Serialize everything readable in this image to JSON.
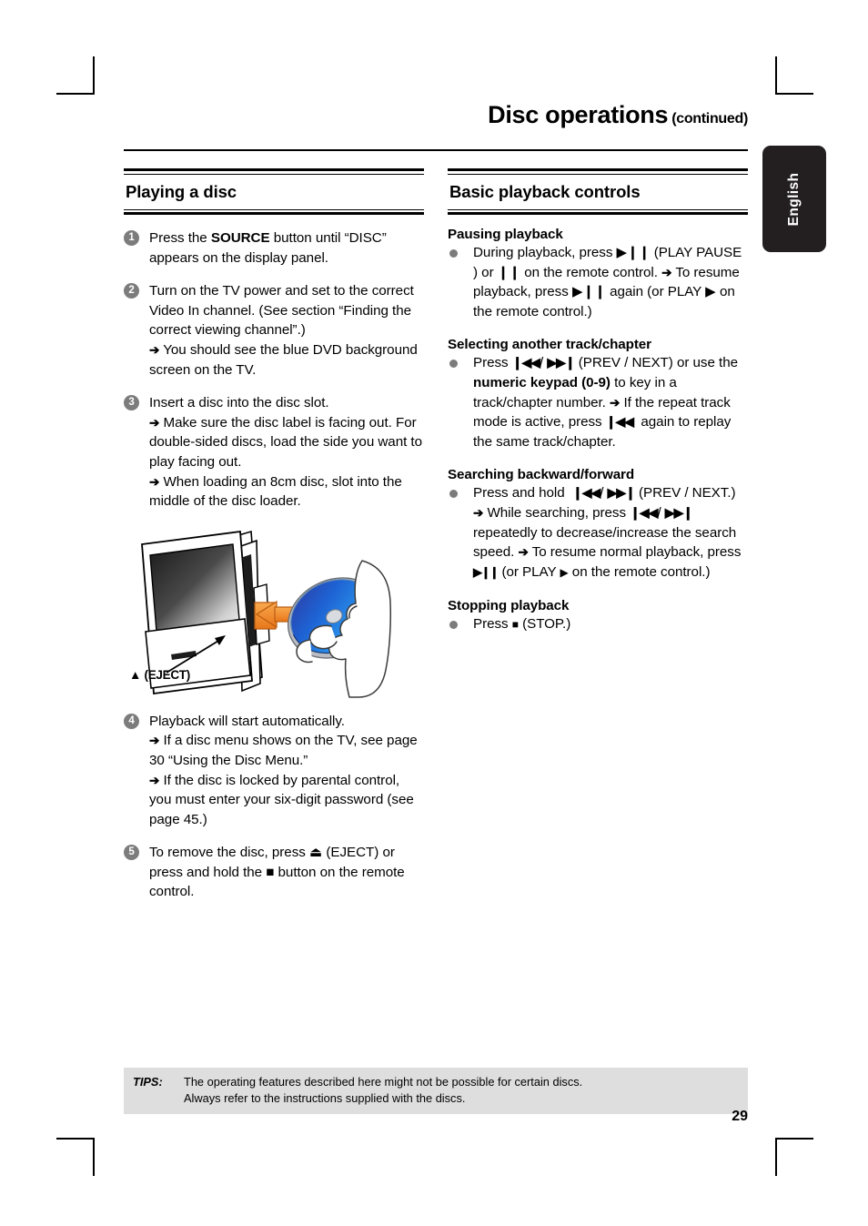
{
  "header": {
    "title": "Disc operations",
    "continued": "(continued)"
  },
  "lang_tab": {
    "label": "English",
    "bg": "#231f20",
    "fg": "#ffffff"
  },
  "left_column": {
    "heading": "Playing a disc",
    "steps": [
      {
        "num": "1",
        "lines": [
          {
            "type": "main",
            "text": "Press the ",
            "bold": "SOURCE",
            "tail": " button until “DISC” appears on the display panel."
          }
        ]
      },
      {
        "num": "2",
        "lines": [
          {
            "type": "main",
            "text": "Turn on the TV power and set to the correct Video In channel.  (See section “Finding the correct viewing channel”.)"
          },
          {
            "type": "arrow",
            "text": "You should see the blue DVD background screen on the TV."
          }
        ]
      },
      {
        "num": "3",
        "lines": [
          {
            "type": "main",
            "text": "Insert a disc into the disc slot."
          },
          {
            "type": "arrow",
            "text": "Make sure the disc label is facing out. For double-sided discs, load the side you want to play facing out."
          },
          {
            "type": "arrow",
            "text": "When loading an 8cm disc, slot into the middle of the disc loader."
          }
        ]
      },
      {
        "num": "4",
        "lines": [
          {
            "type": "main",
            "text": "Playback will start automatically."
          },
          {
            "type": "arrow",
            "text": "If a disc menu shows on the TV, see page 30 “Using the Disc Menu.”"
          },
          {
            "type": "arrow",
            "text": "If the disc is locked by parental control, you must enter your six-digit password (see page 45.)"
          }
        ]
      },
      {
        "num": "5",
        "lines": [
          {
            "type": "main",
            "text": "To remove the disc, press ⏏ (EJECT) or press and hold the ■ button on the remote control."
          }
        ]
      }
    ],
    "figure": {
      "caption": "▲ (EJECT)",
      "description": "flat-panel DVD player with hand inserting blue disc",
      "arrow_color": "#f08c2a",
      "disc_color": "#1656c8"
    }
  },
  "right_column": {
    "heading": "Basic playback controls",
    "sections": [
      {
        "title": "Pausing playback",
        "lines": [
          {
            "type": "main",
            "text": "During playback, press ▶❙❙  (PLAY PAUSE ) or ❙❙  on the remote control."
          },
          {
            "type": "arrow",
            "text": "To resume playback, press ▶❙❙ again (or PLAY ▶ on the remote control.)"
          }
        ]
      },
      {
        "title": "Selecting another track/chapter",
        "lines": [
          {
            "type": "main",
            "text": "Press ❙◀◀/ ▶▶❙ (PREV / NEXT) or use the numeric keypad (0-9) to key in a track/chapter number."
          },
          {
            "type": "arrow",
            "text": "If the repeat track mode is active, press ❙◀◀  again to replay the same track/chapter."
          }
        ]
      },
      {
        "title": "Searching backward/forward",
        "lines": [
          {
            "type": "main",
            "text": "Press and hold  ❙◀◀/ ▶▶❙ (PREV / NEXT.)"
          },
          {
            "type": "arrow",
            "text": "While searching, press ❙◀◀/ ▶▶❙ repeatedly to decrease/increase the search speed."
          },
          {
            "type": "arrow",
            "text": "To resume normal playback, press ▶❙❙ (or PLAY ▶ on the remote control.)"
          }
        ]
      },
      {
        "title": "Stopping playback",
        "lines": [
          {
            "type": "main",
            "text": "Press ■ (STOP.)"
          }
        ]
      }
    ]
  },
  "tips": {
    "label": "TIPS:",
    "line1": "The operating features described here might not be possible for certain discs.",
    "line2": "Always refer to the instructions supplied with the discs."
  },
  "page_number": "29"
}
